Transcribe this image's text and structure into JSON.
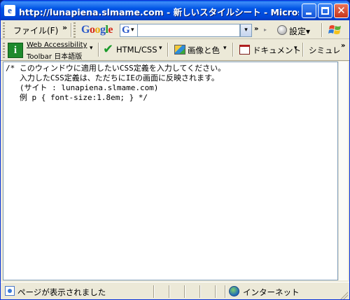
{
  "window": {
    "title": "http://lunapiena.slmame.com - 新しいスタイルシート - Microsof...",
    "title_icon_glyph": "e"
  },
  "menubar": {
    "file_menu": "ファイル(F)",
    "overflow": "»"
  },
  "google_bar": {
    "logo": [
      "G",
      "o",
      "o",
      "g",
      "l",
      "e"
    ],
    "search_button_letter": "G",
    "search_input_value": "",
    "overflow": "»",
    "settings_label": "設定▾"
  },
  "toolbar": {
    "wat_line1": "Web Accessibility",
    "wat_line2": "Toolbar  日本語版",
    "wat_icon_glyph": "i",
    "html_css_label": "HTML/CSS",
    "images_label": "画像と色",
    "document_label": "ドキュメント",
    "simulate_label": "シミュレ",
    "overflow": "»",
    "dropdown_arrow": "▾"
  },
  "editor": {
    "css_text": "/* このウィンドウに適用したいCSS定義を入力してください。\n   入力したCSS定義は、ただちにIEの画面に反映されます。\n   (サイト : lunapiena.slmame.com)\n   例 p { font-size:1.8em; } */"
  },
  "statusbar": {
    "status_text": "ページが表示されました",
    "zone_text": "インターネット"
  },
  "colors": {
    "titlebar": "#0055e5",
    "chrome": "#ece9d8",
    "close_button": "#c6361c"
  }
}
